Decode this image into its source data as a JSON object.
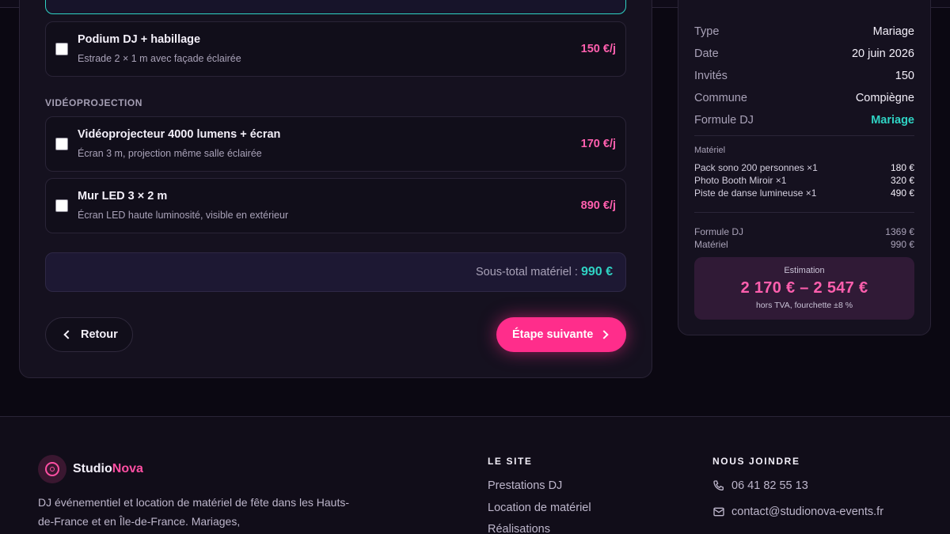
{
  "options": [
    {
      "name": "Podium DJ + habillage",
      "desc": "Estrade 2 × 1 m avec façade éclairée",
      "price": "150 €/j"
    }
  ],
  "video": {
    "section_title": "VIDÉOPROJECTION",
    "items": [
      {
        "name": "Vidéoprojecteur 4000 lumens + écran",
        "desc": "Écran 3 m, projection même salle éclairée",
        "price": "170 €/j"
      },
      {
        "name": "Mur LED 3 × 2 m",
        "desc": "Écran LED haute luminosité, visible en extérieur",
        "price": "890 €/j"
      }
    ]
  },
  "subtotal": {
    "label": "Sous-total matériel :",
    "value": "990 €"
  },
  "nav": {
    "back": "Retour",
    "next": "Étape suivante"
  },
  "summary": {
    "rows": [
      {
        "k": "Type",
        "v": "Mariage"
      },
      {
        "k": "Date",
        "v": "20 juin 2026"
      },
      {
        "k": "Invités",
        "v": "150"
      },
      {
        "k": "Commune",
        "v": "Compiègne"
      },
      {
        "k": "Formule DJ",
        "v": "Mariage"
      }
    ],
    "materiel_label": "Matériel",
    "materiel": [
      {
        "k": "Pack sono 200 personnes ×1",
        "v": "180 €"
      },
      {
        "k": "Photo Booth Miroir ×1",
        "v": "320 €"
      },
      {
        "k": "Piste de danse lumineuse ×1",
        "v": "490 €"
      }
    ],
    "totals": [
      {
        "k": "Formule DJ",
        "v": "1369 €"
      },
      {
        "k": "Matériel",
        "v": "990 €"
      }
    ],
    "estimate": {
      "label": "Estimation",
      "range": "2 170 € – 2 547 €",
      "note": "hors TVA, fourchette ±8 %"
    }
  },
  "footer": {
    "brand_a": "Studio",
    "brand_b": "Nova",
    "desc": "DJ événementiel et location de matériel de fête dans les Hauts-de-France et en Île-de-France. Mariages,",
    "site_head": "LE SITE",
    "site_links": [
      "Prestations DJ",
      "Location de matériel",
      "Réalisations"
    ],
    "contact_head": "NOUS JOINDRE",
    "phone": "06 41 82 55 13",
    "email": "contact@studionova-events.fr"
  },
  "colors": {
    "accent_pink": "#ff2d8b",
    "accent_teal": "#2fd3c4",
    "bg": "#0b0812"
  }
}
